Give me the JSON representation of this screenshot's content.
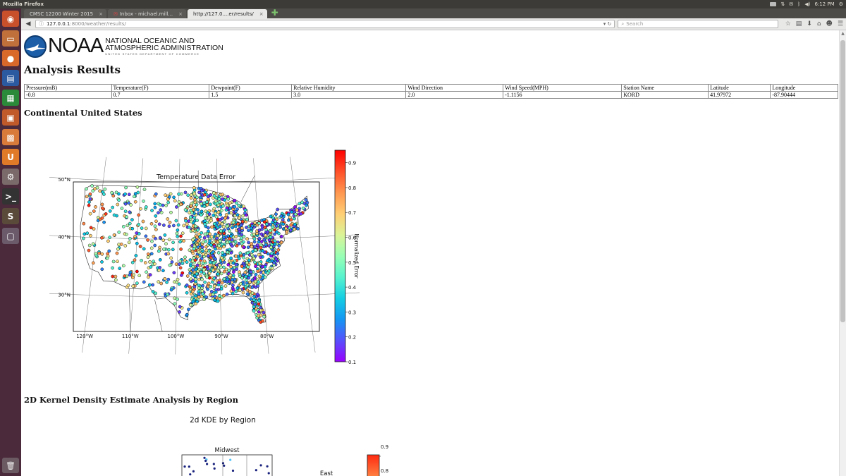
{
  "system": {
    "window_title": "Mozilla Firefox",
    "clock": "6:12 PM",
    "launcher": [
      {
        "name": "dash-home",
        "color": "#c8502a",
        "glyph": "◉"
      },
      {
        "name": "files",
        "color": "#c0703a",
        "glyph": "▭"
      },
      {
        "name": "firefox",
        "color": "#d8692a",
        "glyph": "●"
      },
      {
        "name": "writer",
        "color": "#2c5aa0",
        "glyph": "▤"
      },
      {
        "name": "calc",
        "color": "#2a8a3a",
        "glyph": "▦"
      },
      {
        "name": "impress",
        "color": "#c05a2a",
        "glyph": "▣"
      },
      {
        "name": "software-center",
        "color": "#d77a3a",
        "glyph": "▩"
      },
      {
        "name": "ubuntu-one",
        "color": "#e07a28",
        "glyph": "U"
      },
      {
        "name": "system-settings",
        "color": "#7a6a6a",
        "glyph": "⚙"
      },
      {
        "name": "terminal",
        "color": "#333333",
        "glyph": ">_"
      },
      {
        "name": "sublime-text",
        "color": "#5a4a3a",
        "glyph": "S"
      },
      {
        "name": "workspaces",
        "color": "#6a5a6a",
        "glyph": "▢"
      }
    ]
  },
  "browser": {
    "tabs": [
      {
        "label": "CMSC 12200 Winter 2015",
        "active": false
      },
      {
        "label": "Inbox - michael.mill...",
        "active": false
      },
      {
        "label": "http://127.0....er/results/",
        "active": true
      }
    ],
    "url_host": "127.0.0.1",
    "url_path": ":8000/weather/results/",
    "search_placeholder": "Search"
  },
  "page": {
    "logo_wordmark": "NOAA",
    "agency_line1": "NATIONAL OCEANIC AND",
    "agency_line2": "ATMOSPHERIC ADMINISTRATION",
    "agency_dept": "UNITED STATES DEPARTMENT OF COMMERCE",
    "heading": "Analysis Results",
    "table": {
      "headers": [
        "Pressure(mB)",
        "Temperature(F)",
        "Dewpoint(F)",
        "Relative Humidity",
        "Wind Direction",
        "Wind Speed(MPH)",
        "Station Name",
        "Latitude",
        "Longitude"
      ],
      "row": [
        "-0.8",
        "0.7",
        "1.5",
        "3.0",
        "2.0",
        "-1.1156",
        "KORD",
        "41.97972",
        "-87.90444"
      ]
    },
    "section1_title": "Continental United States",
    "section2_title": "2D Kernel Density Estimate Analysis by Region"
  },
  "chart_data": [
    {
      "type": "scatter",
      "title": "Temperature Data Error",
      "colorbar_label": "Normalized Error",
      "colorbar_ticks": [
        0.1,
        0.2,
        0.3,
        0.4,
        0.5,
        0.6,
        0.7,
        0.8,
        0.9
      ],
      "colorbar_range": [
        0.1,
        0.95
      ],
      "colormap": "rainbow",
      "lat_labels": [
        "50°N",
        "40°N",
        "30°N"
      ],
      "lon_labels": [
        "120°W",
        "110°W",
        "100°W",
        "90°W",
        "80°W"
      ],
      "lon_range": [
        -125,
        -66
      ],
      "lat_range": [
        24,
        50
      ],
      "station_count_approx": 1500
    },
    {
      "type": "heatmap",
      "title": "2d KDE by Region",
      "panels": [
        "Midwest",
        "East"
      ],
      "colorbar_ticks": [
        0.9,
        0.8
      ],
      "colormap": "rainbow"
    }
  ]
}
